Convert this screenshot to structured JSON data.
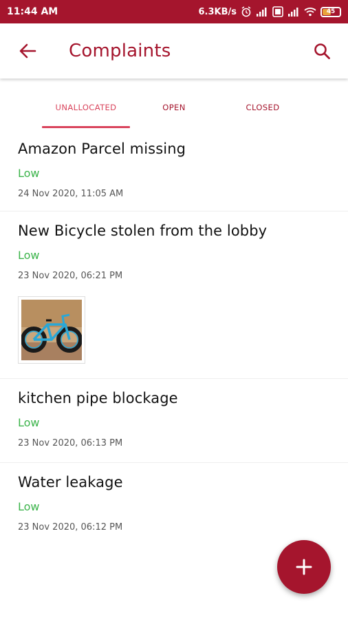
{
  "status_bar": {
    "time": "11:44 AM",
    "net_speed": "6.3KB/s",
    "battery": "45",
    "icons": [
      "alarm-icon",
      "signal-icon",
      "volte-icon",
      "signal-icon",
      "wifi-icon",
      "battery-icon"
    ]
  },
  "app_bar": {
    "title": "Complaints",
    "back_icon": "arrow-left-icon",
    "search_icon": "search-icon"
  },
  "tabs": [
    {
      "label": "UNALLOCATED",
      "active": true
    },
    {
      "label": "OPEN",
      "active": false
    },
    {
      "label": "CLOSED",
      "active": false
    }
  ],
  "complaints": [
    {
      "title": "Amazon Parcel missing",
      "priority": "Low",
      "date": "24 Nov 2020, 11:05 AM",
      "has_image": false
    },
    {
      "title": "New Bicycle stolen from the lobby",
      "priority": "Low",
      "date": "23 Nov 2020, 06:21 PM",
      "has_image": true
    },
    {
      "title": "kitchen pipe blockage",
      "priority": "Low",
      "date": "23 Nov 2020, 06:13 PM",
      "has_image": false
    },
    {
      "title": "Water leakage",
      "priority": "Low",
      "date": "23 Nov 2020, 06:12 PM",
      "has_image": false
    }
  ],
  "fab": {
    "icon": "plus-icon"
  },
  "colors": {
    "primary": "#a5152d",
    "tab_active": "#d9445c",
    "priority_low": "#3cb44b"
  }
}
